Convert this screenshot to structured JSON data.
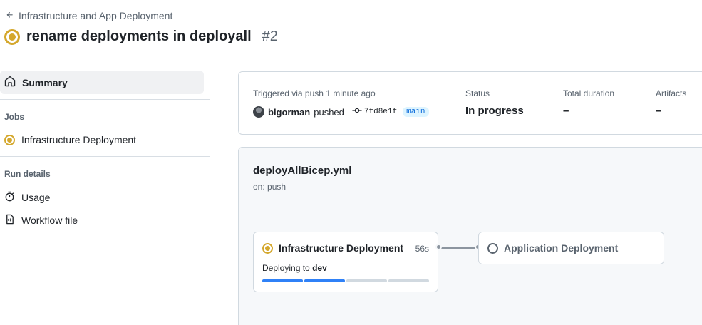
{
  "header": {
    "back_label": "Infrastructure and App Deployment",
    "run_title": "rename deployments in deployall",
    "run_number": "#2"
  },
  "sidebar": {
    "summary_label": "Summary",
    "jobs_section": "Jobs",
    "jobs": [
      {
        "label": "Infrastructure Deployment",
        "status": "in-progress"
      }
    ],
    "run_details_section": "Run details",
    "run_details": [
      {
        "label": "Usage",
        "icon": "stopwatch-icon"
      },
      {
        "label": "Workflow file",
        "icon": "file-code-icon"
      }
    ]
  },
  "summary": {
    "trigger_label": "Triggered via push 1 minute ago",
    "user": "blgorman",
    "action": "pushed",
    "commit": "7fd8e1f",
    "branch": "main",
    "status_label": "Status",
    "status_value": "In progress",
    "duration_label": "Total duration",
    "duration_value": "–",
    "artifacts_label": "Artifacts",
    "artifacts_value": "–"
  },
  "workflow": {
    "file": "deployAllBicep.yml",
    "trigger": "on: push",
    "jobs": [
      {
        "name": "Infrastructure Deployment",
        "duration": "56s",
        "step_prefix": "Deploying to",
        "step_env": "dev",
        "progress_fraction": 0.5,
        "status": "in-progress"
      },
      {
        "name": "Application Deployment",
        "status": "queued"
      }
    ]
  },
  "colors": {
    "in_progress": "#d4a72c",
    "progress_done": "#2f81f7",
    "branch_bg": "#ddf4ff",
    "branch_fg": "#0969da"
  }
}
